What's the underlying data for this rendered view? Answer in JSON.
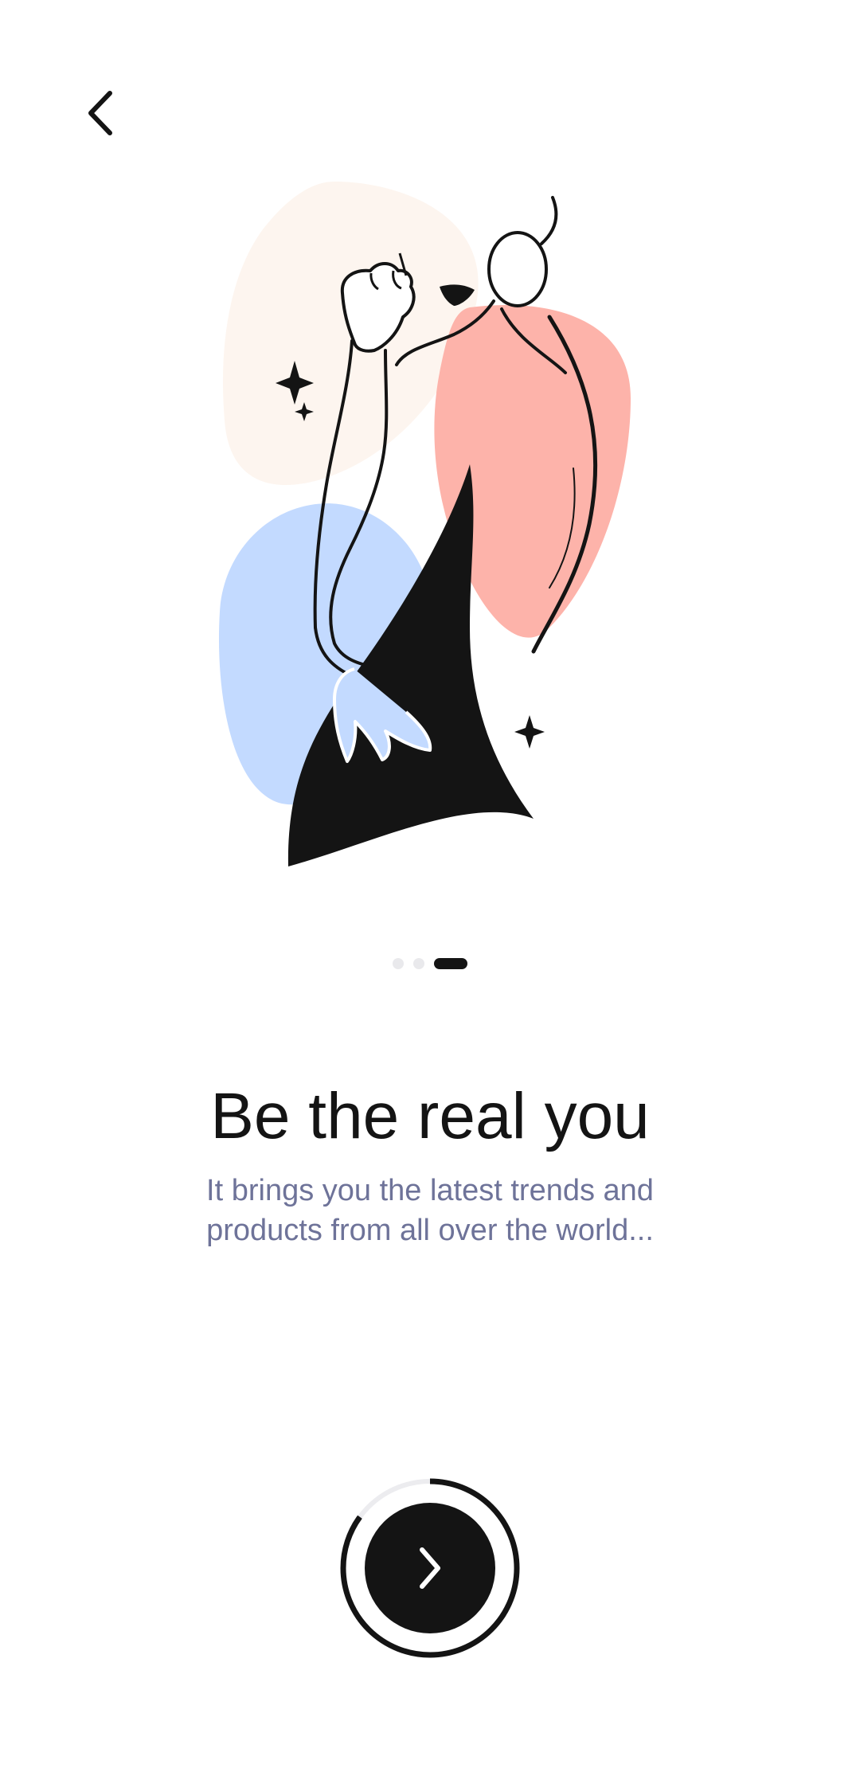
{
  "navigation": {
    "back_icon": "chevron-left-icon"
  },
  "onboarding": {
    "illustration": "woman-line-art-illustration",
    "pager": {
      "total": 3,
      "current": 3
    },
    "title": "Be the real you",
    "subtitle_line1": "It brings you the latest trends and",
    "subtitle_line2": "products from all over the world..."
  },
  "next": {
    "icon": "chevron-right-icon",
    "progress": 0.85
  },
  "colors": {
    "background": "#ffffff",
    "text_primary": "#141414",
    "text_secondary": "#6e7399",
    "blob_peach": "#fdf5ef",
    "blob_pink": "#fdb3aa",
    "blob_blue": "#c3daff",
    "dot_inactive": "#e9e9ec",
    "progress_track": "#ececef"
  }
}
